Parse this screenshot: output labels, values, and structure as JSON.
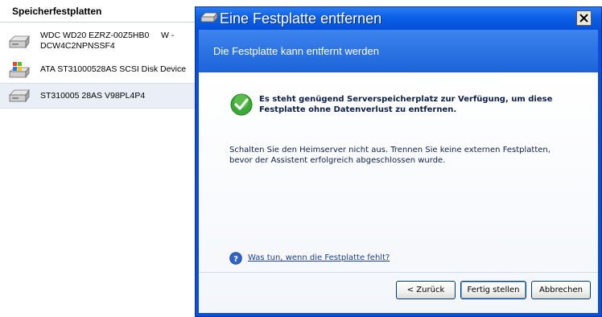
{
  "left_panel": {
    "header": "Speicherfestplatten",
    "disks": [
      {
        "label": "WDC WD20 EZRZ-00Z5HB0     W - DCW4C2NPNSSF4",
        "icon": "hard-disk-icon"
      },
      {
        "label": "ATA ST31000528AS SCSI Disk Device",
        "icon": "windows-disk-icon"
      },
      {
        "label": "ST310005 28AS V98PL4P4",
        "icon": "hard-disk-icon"
      }
    ]
  },
  "dialog": {
    "title": "Eine Festplatte entfernen",
    "subtitle": "Die Festplatte kann entfernt werden",
    "success_message": "Es steht genügend Serverspeicherplatz zur Verfügung, um diese Festplatte ohne Datenverlust zu entfernen.",
    "info_message": "Schalten Sie den Heimserver nicht aus. Trennen Sie keine externen Festplatten, bevor der Assistent erfolgreich abgeschlossen wurde.",
    "help_link": "Was tun, wenn die Festplatte fehlt?",
    "buttons": {
      "back": "< Zurück",
      "finish": "Fertig stellen",
      "cancel": "Abbrechen"
    }
  },
  "colors": {
    "titlebar": "#0b5fe6",
    "header_band": "#2a6fe0",
    "text_dark": "#0d1e4a",
    "selected_row": "#e9eef7",
    "success_green": "#3aa935"
  }
}
